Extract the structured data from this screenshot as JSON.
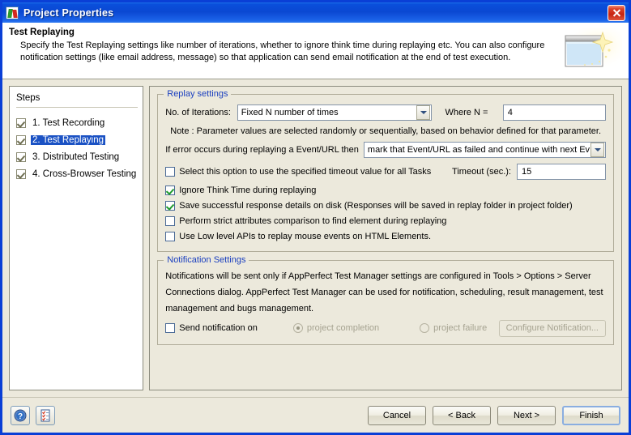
{
  "window": {
    "title": "Project Properties",
    "icon": "app-icon",
    "close_label": "Close"
  },
  "header": {
    "title": "Test Replaying",
    "line1": "Specify the Test Replaying settings like number of iterations, whether to ignore think time during replaying etc. You can also configure",
    "line2": "notification settings (like email address, message) so that application can send email notification at the end of test execution."
  },
  "steps": {
    "heading": "Steps",
    "items": [
      {
        "label": "1. Test Recording",
        "checked": true,
        "selected": false
      },
      {
        "label": "2. Test Replaying",
        "checked": true,
        "selected": true
      },
      {
        "label": "3. Distributed Testing",
        "checked": true,
        "selected": false
      },
      {
        "label": "4. Cross-Browser Testing",
        "checked": true,
        "selected": false
      }
    ]
  },
  "replay_settings": {
    "group_title": "Replay settings",
    "iterations_label": "No. of Iterations:",
    "iterations_value": "Fixed N number of times",
    "where_n_label": "Where N =",
    "where_n_value": "4",
    "note": "Note : Parameter values are selected randomly or sequentially, based on behavior defined for that parameter.",
    "error_label": "If error occurs during replaying a Event/URL then",
    "error_value": "mark that Event/URL as failed and continue with next Event/URL",
    "timeout_checkbox_label": "Select this option to use the specified timeout value for all Tasks",
    "timeout_checkbox_checked": false,
    "timeout_label": "Timeout (sec.):",
    "timeout_value": "15",
    "options": [
      {
        "label": "Ignore Think Time during replaying",
        "checked": true
      },
      {
        "label": "Save successful response details on disk (Responses will be saved in replay folder in project folder)",
        "checked": true
      },
      {
        "label": "Perform strict attributes comparison to find element during replaying",
        "checked": false
      },
      {
        "label": "Use Low level APIs to replay mouse events on HTML Elements.",
        "checked": false
      }
    ]
  },
  "notification_settings": {
    "group_title": "Notification Settings",
    "description_line1": "Notifications will be sent only if AppPerfect Test Manager settings are configured in Tools > Options > Server",
    "description_line2": "Connections dialog. AppPerfect Test Manager can be used for notification, scheduling, result management, test",
    "description_line3": "management and bugs management.",
    "send_notification_label": "Send notification on",
    "send_notification_checked": false,
    "radio_completion_label": "project completion",
    "radio_completion_selected": true,
    "radio_failure_label": "project failure",
    "radio_failure_selected": false,
    "configure_button_label": "Configure Notification..."
  },
  "footer": {
    "help_icon": "help-icon",
    "checklist_icon": "checklist-icon",
    "cancel_label": "Cancel",
    "back_label": "< Back",
    "next_label": "Next >",
    "finish_label": "Finish"
  },
  "colors": {
    "title_bar": "#0A47D2",
    "panel_bg": "#ECE9DC",
    "group_title": "#1A3FBF",
    "selection": "#1B52C4",
    "check_green": "#1F9B2E"
  }
}
